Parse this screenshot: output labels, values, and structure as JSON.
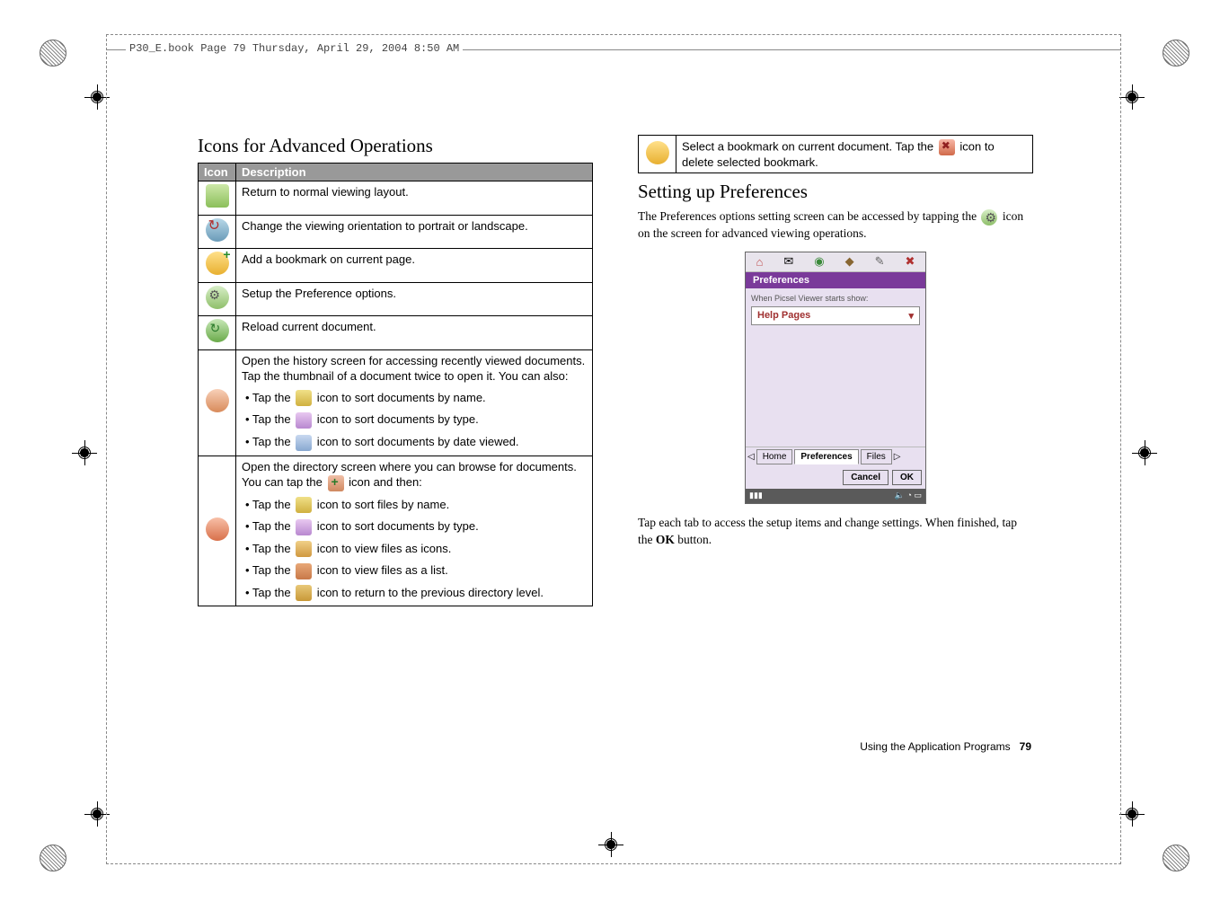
{
  "print": {
    "book_info": "P30_E.book  Page 79  Thursday, April 29, 2004  8:50 AM"
  },
  "left": {
    "title": "Icons for Advanced Operations",
    "headers": {
      "icon": "Icon",
      "desc": "Description"
    },
    "rows": {
      "r1": "Return to normal viewing layout.",
      "r2": "Change the viewing orientation to portrait or landscape.",
      "r3": "Add a bookmark on current page.",
      "r4": "Setup the Preference options.",
      "r5": "Reload current document.",
      "r6_intro": "Open the history screen for accessing recently viewed documents. Tap the thumbnail of a document twice to open it. You can also:",
      "r6_b1a": "• Tap the ",
      "r6_b1b": " icon to sort documents by name.",
      "r6_b2a": "• Tap the ",
      "r6_b2b": " icon to sort documents by type.",
      "r6_b3a": "• Tap the ",
      "r6_b3b": " icon to sort documents by date viewed.",
      "r7_intro_a": "Open the directory screen where you can browse for documents. You can tap the ",
      "r7_intro_b": " icon and then:",
      "r7_b1a": "• Tap the ",
      "r7_b1b": " icon to sort files by name.",
      "r7_b2a": "• Tap the ",
      "r7_b2b": " icon to sort documents by type.",
      "r7_b3a": "• Tap the ",
      "r7_b3b": " icon to view files as icons.",
      "r7_b4a": "• Tap the ",
      "r7_b4b": " icon to view files as a list.",
      "r7_b5a": "• Tap the ",
      "r7_b5b": " icon to return to the previous directory level."
    }
  },
  "right": {
    "bookmark_a": "Select a bookmark on current document. Tap the ",
    "bookmark_b": " icon to delete selected bookmark.",
    "prefs_title": "Setting up Preferences",
    "prefs_p1a": "The Preferences options setting screen can be accessed by tapping the ",
    "prefs_p1b": " icon on the screen for advanced viewing operations.",
    "prefs_p2a": "Tap each tab to access the setup items and change settings. When finished, tap the ",
    "prefs_p2_ok": "OK",
    "prefs_p2b": " button."
  },
  "screenshot": {
    "titlebar": "Preferences",
    "label": "When Picsel Viewer starts show:",
    "dropdown": "Help Pages",
    "tabs": {
      "home": "Home",
      "prefs": "Preferences",
      "files": "Files"
    },
    "buttons": {
      "cancel": "Cancel",
      "ok": "OK"
    }
  },
  "footer": {
    "text": "Using the Application Programs",
    "page": "79"
  }
}
